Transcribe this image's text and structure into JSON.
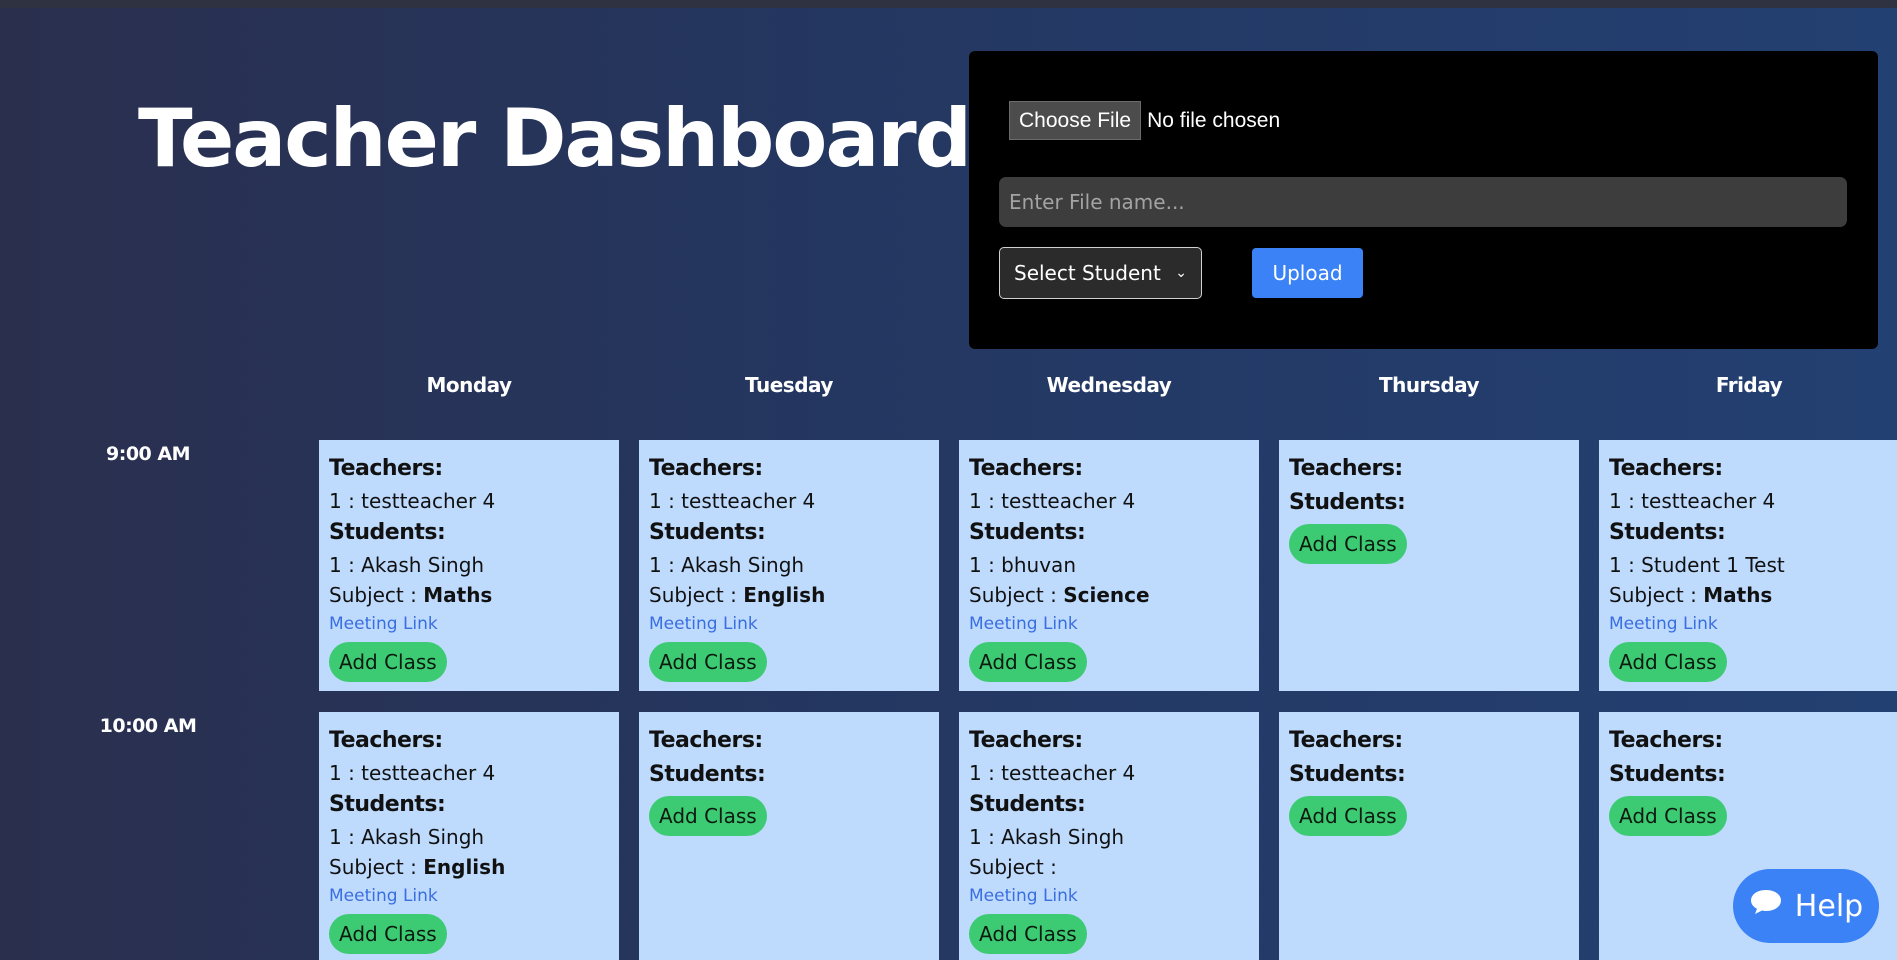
{
  "page_title": "Teacher Dashboard",
  "upload": {
    "choose_file_label": "Choose File",
    "file_status": "No file chosen",
    "filename_placeholder": "Enter File name...",
    "select_student_label": "Select Student",
    "upload_label": "Upload"
  },
  "days": [
    "Monday",
    "Tuesday",
    "Wednesday",
    "Thursday",
    "Friday"
  ],
  "labels": {
    "teachers": "Teachers:",
    "students": "Students:",
    "subject": "Subject :",
    "meeting_link": "Meeting Link",
    "add_class": "Add Class"
  },
  "slots": [
    {
      "time": "9:00 AM",
      "cells": [
        {
          "teacher": "1 : testteacher 4",
          "student": "1 : Akash Singh",
          "subject": "Maths"
        },
        {
          "teacher": "1 : testteacher 4",
          "student": "1 : Akash Singh",
          "subject": "English"
        },
        {
          "teacher": "1 : testteacher 4",
          "student": "1 : bhuvan",
          "subject": "Science"
        },
        {},
        {
          "teacher": "1 : testteacher 4",
          "student": "1 : Student 1 Test",
          "subject": "Maths"
        }
      ]
    },
    {
      "time": "10:00 AM",
      "cells": [
        {
          "teacher": "1 : testteacher 4",
          "student": "1 : Akash Singh",
          "subject": "English"
        },
        {},
        {
          "teacher": "1 : testteacher 4",
          "student": "1 : Akash Singh",
          "subject": ""
        },
        {},
        {}
      ]
    }
  ],
  "help": {
    "label": "Help",
    "icon": "chat-bubble-icon"
  },
  "colors": {
    "cell_bg": "#bedbfe",
    "add_class_btn": "#3ccb73",
    "primary_btn": "#3b82f6",
    "link": "#3a6ee0"
  }
}
